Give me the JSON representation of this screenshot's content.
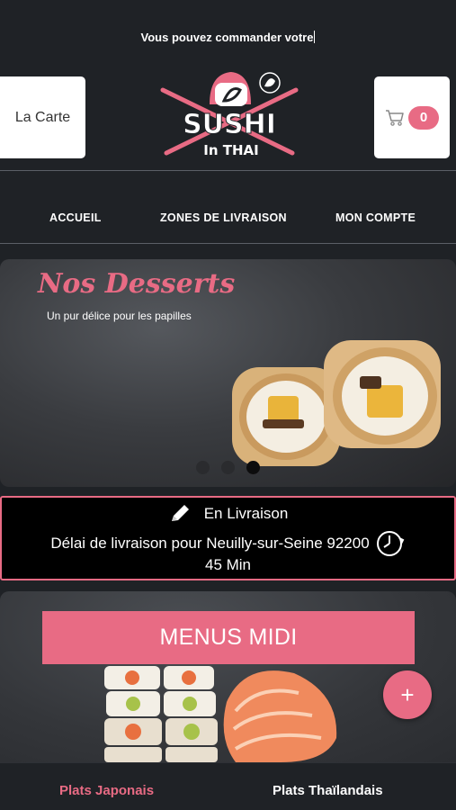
{
  "announcement": {
    "text": "Vous pouvez commander votre"
  },
  "header": {
    "menu_button_label": "La Carte",
    "cart_count": "0",
    "logo_text": "SUSHI",
    "logo_subtext": "In THAI"
  },
  "nav": {
    "items": [
      {
        "label": "ACCUEIL"
      },
      {
        "label": "ZONES DE LIVRAISON"
      },
      {
        "label": "MON COMPTE"
      }
    ]
  },
  "banner": {
    "title": "Nos Desserts",
    "subtitle": "Un pur délice pour les papilles",
    "slide_count": 3,
    "active_slide": 3
  },
  "delivery": {
    "mode": "En Livraison",
    "delay_text": "Délai de livraison pour Neuilly-sur-Seine 92200",
    "delay_value": "45 Min"
  },
  "menu_card": {
    "label": "MENUS MIDI",
    "add_symbol": "+"
  },
  "bottom_tabs": [
    {
      "label": "Plats Japonais",
      "active": true
    },
    {
      "label": "Plats Thaïlandais",
      "active": false
    }
  ],
  "colors": {
    "accent": "#e86b84",
    "background": "#1f2226",
    "delivery_bg": "#000000"
  }
}
